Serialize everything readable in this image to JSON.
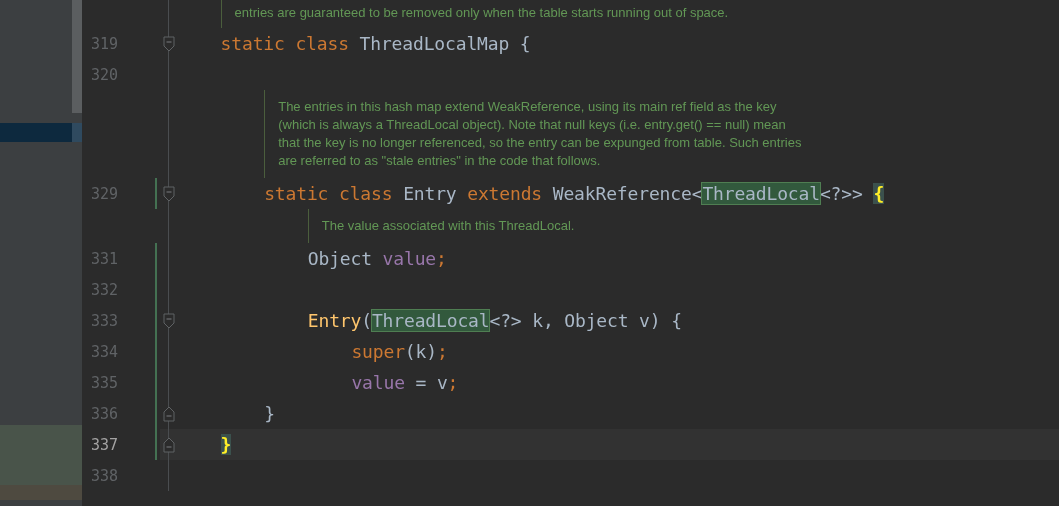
{
  "editor": {
    "lines": [
      {
        "kind": "doc",
        "text": [
          "entries are guaranteed to be removed only when the table starts running out of space."
        ]
      },
      {
        "kind": "code",
        "number": "319",
        "fold_open": true,
        "changed": false,
        "current": false,
        "tokens": [
          {
            "kind": "keyword",
            "text": "static class "
          },
          {
            "kind": "plain",
            "text": "ThreadLocalMap {"
          }
        ],
        "children": [
          {
            "kind": "code",
            "number": "320",
            "changed": false,
            "current": false
          },
          {
            "kind": "doc",
            "text": [
              "The entries in this hash map extend WeakReference, using its main ref field as the key",
              "(which is always a ThreadLocal object). Note that null keys (i.e. entry.get() == null) mean",
              "that the key is no longer referenced, so the entry can be expunged from table. Such entries",
              "are referred to as \"stale entries\" in the code that follows."
            ]
          },
          {
            "kind": "code",
            "number": "329",
            "fold_open": true,
            "changed": true,
            "current": false,
            "tokens": [
              {
                "kind": "keyword",
                "text": "static class "
              },
              {
                "kind": "plain",
                "text": "Entry "
              },
              {
                "kind": "keyword",
                "text": "extends "
              },
              {
                "kind": "plain",
                "text": "WeakReference<"
              },
              {
                "kind": "plain",
                "text": "ThreadLocal",
                "usage_highlight": true
              },
              {
                "kind": "plain",
                "text": "<?>> "
              },
              {
                "kind": "plain",
                "text": "{",
                "brace_match": true
              }
            ],
            "children": [
              {
                "kind": "doc",
                "text": [
                  "The value associated with this ThreadLocal."
                ]
              },
              {
                "kind": "code",
                "number": "331",
                "changed": true,
                "current": false,
                "tokens": [
                  {
                    "kind": "plain",
                    "text": "Object "
                  },
                  {
                    "kind": "field",
                    "text": "value"
                  },
                  {
                    "kind": "keyword",
                    "text": ";"
                  }
                ]
              },
              {
                "kind": "code",
                "number": "332",
                "changed": true,
                "current": false
              },
              {
                "kind": "code",
                "number": "333",
                "fold_open": true,
                "changed": true,
                "current": false,
                "tokens": [
                  {
                    "kind": "method",
                    "text": "Entry"
                  },
                  {
                    "kind": "plain",
                    "text": "("
                  },
                  {
                    "kind": "plain",
                    "text": "ThreadLocal",
                    "usage_highlight": true
                  },
                  {
                    "kind": "plain",
                    "text": "<?> k, Object v) {"
                  }
                ],
                "children": [
                  {
                    "kind": "code",
                    "number": "334",
                    "changed": true,
                    "current": false,
                    "tokens": [
                      {
                        "kind": "keyword",
                        "text": "super"
                      },
                      {
                        "kind": "plain",
                        "text": "(k)"
                      },
                      {
                        "kind": "keyword",
                        "text": ";"
                      }
                    ]
                  },
                  {
                    "kind": "code",
                    "number": "335",
                    "changed": true,
                    "current": false,
                    "tokens": [
                      {
                        "kind": "field",
                        "text": "value"
                      },
                      {
                        "kind": "plain",
                        "text": " = v"
                      },
                      {
                        "kind": "keyword",
                        "text": ";"
                      }
                    ]
                  }
                ]
              },
              {
                "kind": "code",
                "number": "336",
                "fold_close": true,
                "changed": true,
                "current": false,
                "tokens": [
                  {
                    "kind": "plain",
                    "text": "}"
                  }
                ]
              }
            ]
          },
          {
            "kind": "code",
            "number": "337",
            "fold_close": true,
            "changed": true,
            "current": true,
            "tokens": [
              {
                "kind": "plain",
                "text": "}",
                "brace_match": true
              }
            ]
          }
        ]
      },
      {
        "kind": "code",
        "number": "338",
        "changed": false,
        "current": false
      }
    ]
  }
}
